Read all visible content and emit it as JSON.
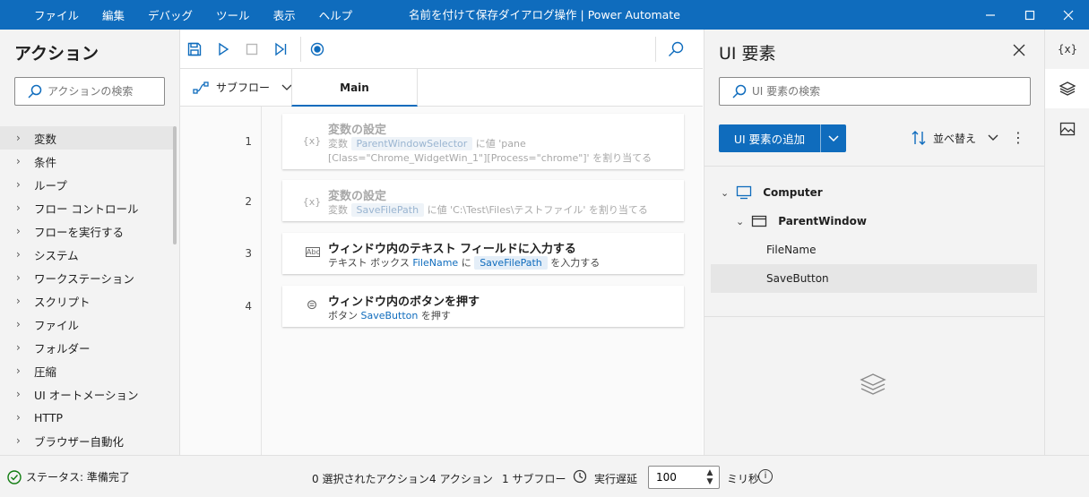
{
  "window": {
    "title": "名前を付けて保存ダイアログ操作 | Power Automate",
    "menu": [
      "ファイル",
      "編集",
      "デバッグ",
      "ツール",
      "表示",
      "ヘルプ"
    ]
  },
  "actions_panel": {
    "title": "アクション",
    "search_placeholder": "アクションの検索",
    "categories": [
      "変数",
      "条件",
      "ループ",
      "フロー コントロール",
      "フローを実行する",
      "システム",
      "ワークステーション",
      "スクリプト",
      "ファイル",
      "フォルダー",
      "圧縮",
      "UI オートメーション",
      "HTTP",
      "ブラウザー自動化"
    ]
  },
  "tabs": {
    "subflow_label": "サブフロー",
    "main_label": "Main"
  },
  "flow": {
    "steps": [
      {
        "no": "1",
        "icon": "{x}",
        "title": "変数の設定",
        "d1": "変数",
        "d2": "ParentWindowSelector",
        "d3": "に値 'pane",
        "d4": "[Class=\"Chrome_WidgetWin_1\"][Process=\"chrome\"]' を割り当てる"
      },
      {
        "no": "2",
        "icon": "{x}",
        "title": "変数の設定",
        "d1": "変数",
        "d2": "SaveFilePath",
        "d3": "に値 'C:\\Test\\Files\\テストファイル' を割り当てる"
      },
      {
        "no": "3",
        "icon": "Abc",
        "title": "ウィンドウ内のテキスト フィールドに入力する",
        "d1": "テキスト ボックス",
        "d2": "FileName",
        "d3": "に",
        "d4": "SaveFilePath",
        "d5": "を入力する"
      },
      {
        "no": "4",
        "icon": "⊜",
        "title": "ウィンドウ内のボタンを押す",
        "d1": "ボタン",
        "d2": "SaveButton",
        "d3": "を押す"
      }
    ]
  },
  "ui_panel": {
    "title": "UI 要素",
    "search_placeholder": "UI 要素の検索",
    "add_label": "UI 要素の追加",
    "sort_label": "並べ替え",
    "more_label": "⋮",
    "tree": {
      "computer": "Computer",
      "parent": "ParentWindow",
      "children": [
        "FileName",
        "SaveButton"
      ]
    }
  },
  "side_tabs": {
    "variables_label": "{x}"
  },
  "status": {
    "state": "ステータス: 準備完了",
    "selected": "0 選択されたアクション",
    "actions": "4 アクション",
    "subflows": "1 サブフロー",
    "delay_label": "実行遅延",
    "delay_value": "100",
    "unit": "ミリ秒",
    "info": "i",
    "spin_up": "▲",
    "spin_down": "▼"
  },
  "colors": {
    "accent": "#0f6cbd",
    "success": "#107c10"
  }
}
